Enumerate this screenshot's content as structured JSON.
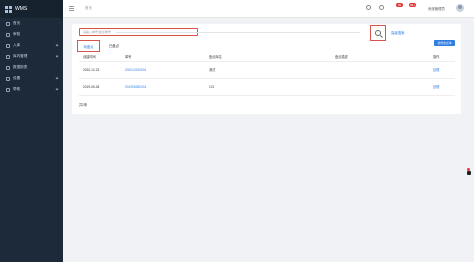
{
  "app": {
    "logo_text": "WMS"
  },
  "sidebar": {
    "items": [
      {
        "label": "首页",
        "icon": "home-icon",
        "has_children": false
      },
      {
        "label": "审核",
        "icon": "audit-icon",
        "has_children": false
      },
      {
        "label": "入库",
        "icon": "inbound-icon",
        "has_children": true
      },
      {
        "label": "库内管理",
        "icon": "warehouse-icon",
        "has_children": true
      },
      {
        "label": "数据报表",
        "icon": "report-icon",
        "has_children": false
      },
      {
        "label": "设置",
        "icon": "settings-icon",
        "has_children": true
      },
      {
        "label": "帮助",
        "icon": "help-icon",
        "has_children": true
      }
    ]
  },
  "topbar": {
    "breadcrumb": "首页",
    "badge_1": "99",
    "badge_2": "99+",
    "user_name": "系统管理员"
  },
  "search": {
    "placeholder": "请输入单号/盘点单号",
    "advanced_label": "高级搜索"
  },
  "tabs": [
    {
      "label": "待盘点",
      "active": true
    },
    {
      "label": "已盘点",
      "active": false
    }
  ],
  "toolbar": {
    "new_label": "新增盘点单"
  },
  "table": {
    "headers": [
      "创建时间",
      "单号",
      "盘点库位",
      "盘点描述",
      "操作"
    ],
    "rows": [
      {
        "created": "2020-12-23",
        "number": "202012230001",
        "location": "测试",
        "description": "",
        "action": "处理"
      },
      {
        "created": "2019-05-28",
        "number": "201905280001",
        "location": "121",
        "description": "",
        "action": "处理"
      }
    ]
  },
  "footer": {
    "total": "共2条"
  },
  "colors": {
    "sidebar": "#1c2a3a",
    "accent": "#2f7de1",
    "highlight": "#d9534f",
    "badge": "#e5373a"
  }
}
